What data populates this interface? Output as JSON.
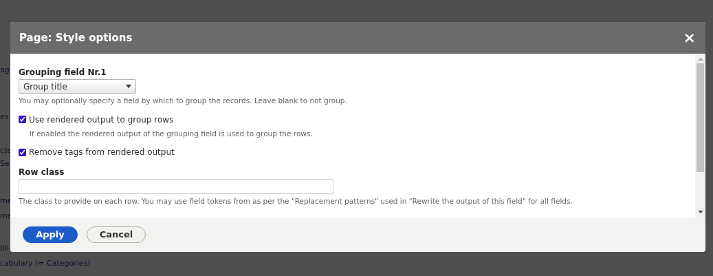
{
  "background": {
    "fragments": [
      "ag",
      "es",
      "cte",
      "Se",
      "me",
      "me",
      "bli",
      "cabulary (= Categories)"
    ]
  },
  "dialog": {
    "title": "Page: Style options",
    "close": "×",
    "grouping": {
      "label": "Grouping field Nr.1",
      "value": "Group title",
      "description": "You may optionally specify a field by which to group the records. Leave blank to not group."
    },
    "options": [
      {
        "label": "Use rendered output to group rows",
        "checked": true,
        "description": "If enabled the rendered output of the grouping field is used to group the rows."
      },
      {
        "label": "Remove tags from rendered output",
        "checked": true
      }
    ],
    "row_class": {
      "label": "Row class",
      "description": "The class to provide on each row. You may use field tokens from as per the \"Replacement patterns\" used in \"Rewrite the output of this field\" for all fields."
    },
    "buttons": [
      {
        "label": "Apply",
        "kind": "primary"
      },
      {
        "label": "Cancel",
        "kind": "secondary"
      }
    ]
  }
}
